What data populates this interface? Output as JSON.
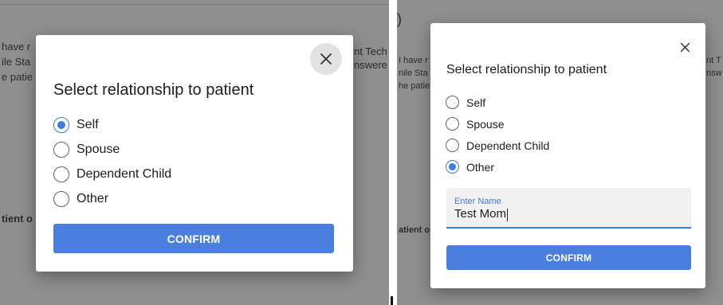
{
  "left": {
    "background_text": {
      "line1": "have r",
      "line2": "ile Sta",
      "line3": "e patie",
      "right1": "nt Tech",
      "right2": "nswere",
      "bold1": "tient o"
    },
    "modal": {
      "title": "Select relationship to patient",
      "options": [
        {
          "label": "Self",
          "checked": true
        },
        {
          "label": "Spouse",
          "checked": false
        },
        {
          "label": "Dependent Child",
          "checked": false
        },
        {
          "label": "Other",
          "checked": false
        }
      ],
      "close_glyph": "✕",
      "confirm_label": "CONFIRM"
    }
  },
  "right": {
    "background_text": {
      "paren": ")",
      "line1": "I have r",
      "line2": "nile Sta",
      "line3": "he patie",
      "right1": "nt T",
      "right2": "nsw",
      "bold1": "atient o"
    },
    "modal": {
      "title": "Select relationship to patient",
      "options": [
        {
          "label": "Self",
          "checked": false
        },
        {
          "label": "Spouse",
          "checked": false
        },
        {
          "label": "Dependent Child",
          "checked": false
        },
        {
          "label": "Other",
          "checked": true
        }
      ],
      "close_glyph": "✕",
      "name_field": {
        "label": "Enter Name",
        "value": "Test Mom"
      },
      "confirm_label": "CONFIRM"
    }
  },
  "colors": {
    "accent": "#4a7fe0",
    "overlay": "#8f8f8f",
    "radio_border": "#5f6368"
  }
}
